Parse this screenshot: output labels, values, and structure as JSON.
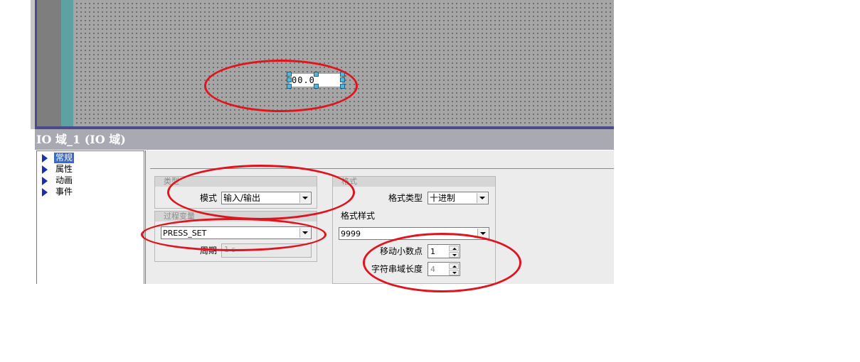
{
  "canvas": {
    "io_field_value": "00.0"
  },
  "properties": {
    "title": "IO 域_1 (IO 域)",
    "tree": [
      {
        "label": "常规",
        "selected": true
      },
      {
        "label": "属性",
        "selected": false
      },
      {
        "label": "动画",
        "selected": false
      },
      {
        "label": "事件",
        "selected": false
      }
    ],
    "type_group": {
      "header": "类型",
      "mode_label": "模式",
      "mode_value": "输入/输出"
    },
    "process_group": {
      "header": "过程变量",
      "tag_value": "PRESS_SET",
      "period_label": "周期",
      "period_value": "1 s"
    },
    "format_group": {
      "header": "格式",
      "format_type_label": "格式类型",
      "format_type_value": "十进制",
      "format_pattern_label": "格式样式",
      "format_pattern_value": "9999",
      "shift_decimal_label": "移动小数点",
      "shift_decimal_value": "1",
      "field_length_label": "字符串域长度",
      "field_length_value": "4"
    }
  },
  "colors": {
    "annotation": "#e0141e",
    "selection": "#3c6ac9",
    "canvas": "#a6a6a6"
  }
}
